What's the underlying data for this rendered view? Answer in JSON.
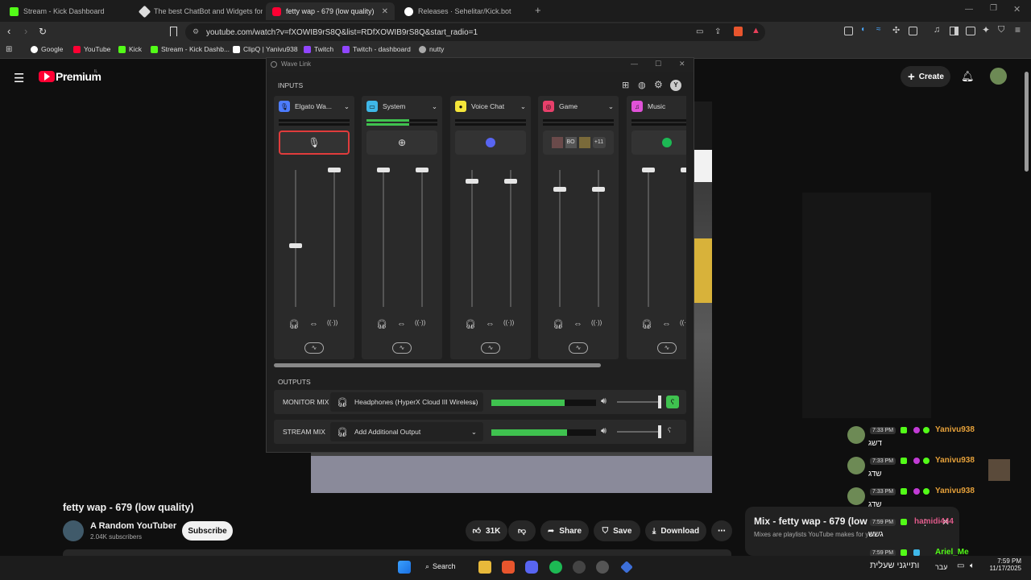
{
  "browser": {
    "tabs": [
      {
        "label": "Stream - Kick Dashboard",
        "color": "#53fc18"
      },
      {
        "label": "The best ChatBot and Widgets for Ki",
        "color": "#dddddd"
      },
      {
        "label": "fetty wap - 679 (low quality)",
        "color": "#ff0033"
      },
      {
        "label": "Releases · Sehelitar/Kick.bot",
        "color": "#ffffff"
      }
    ],
    "url": "youtube.com/watch?v=fXOWIB9rS8Q&list=RDfXOWIB9rS8Q&start_radio=1",
    "bookmarks": [
      "Google",
      "YouTube",
      "Kick",
      "Stream - Kick Dashb...",
      "ClipQ | Yanivu938",
      "Twitch",
      "Twitch - dashboard",
      "nutty"
    ]
  },
  "youtube": {
    "logo": "Premium",
    "logo_suffix": "IL",
    "create_label": "Create",
    "video_title": "fetty wap - 679 (low quality)",
    "channel_name": "A Random YouTuber",
    "subscribers": "2.04K subscribers",
    "subscribe_label": "Subscribe",
    "likes": "31K",
    "share_label": "Share",
    "save_label": "Save",
    "download_label": "Download",
    "mix_title": "Mix - fetty wap - 679 (low",
    "mix_subtitle": "Mixes are playlists YouTube makes for you"
  },
  "chat": [
    {
      "time": "7:33 PM",
      "user": "Yanivu938",
      "message": "דשג"
    },
    {
      "time": "7:33 PM",
      "user": "Yanivu938",
      "message": "שדג"
    },
    {
      "time": "7:33 PM",
      "user": "Yanivu938",
      "message": "שדג"
    },
    {
      "time": "7:59 PM",
      "user": "hamidi444",
      "message": "גשש"
    },
    {
      "time": "7:59 PM",
      "user": "Ariel_Me",
      "message": ""
    }
  ],
  "wavelink": {
    "title": "Wave Link",
    "inputs_label": "INPUTS",
    "outputs_label": "OUTPUTS",
    "avatar_letter": "Y",
    "channels": [
      {
        "name": "Elgato Wa...",
        "icon": "mic-icon",
        "color": "#4d7cff",
        "meter": 0,
        "left_level": 0.45,
        "right_level": 1.0
      },
      {
        "name": "System",
        "icon": "monitor-icon",
        "color": "#3fb7e8",
        "meter": 0.6,
        "left_level": 1.0,
        "right_level": 1.0
      },
      {
        "name": "Voice Chat",
        "icon": "chat-icon",
        "color": "#f5e63a",
        "meter": 0,
        "left_level": 0.92,
        "right_level": 0.92
      },
      {
        "name": "Game",
        "icon": "gamepad-icon",
        "color": "#e8406b",
        "meter": 0,
        "left_level": 0.86,
        "right_level": 0.86
      },
      {
        "name": "Music",
        "icon": "music-icon",
        "color": "#e052d8",
        "meter": 0,
        "left_level": 1.0,
        "right_level": 1.0
      }
    ],
    "game_badge": "+11",
    "game_app_1": "BO",
    "outputs": [
      {
        "label": "MONITOR MIX",
        "device": "Headphones (HyperX Cloud III Wireless)",
        "level": 0.7
      },
      {
        "label": "STREAM MIX",
        "device": "Add Additional Output",
        "level": 0.72
      }
    ]
  },
  "taskbar": {
    "search_label": "Search",
    "lang_label": "עבר",
    "tray_text": "ותייגני שעלית",
    "time": "7:59 PM",
    "date": "11/17/2025"
  }
}
